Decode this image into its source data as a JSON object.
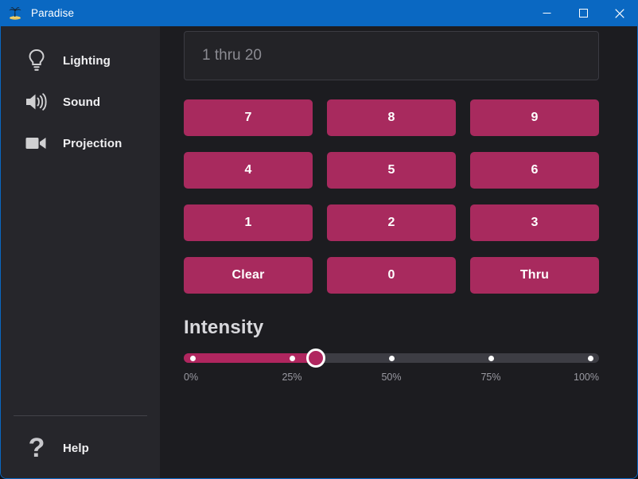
{
  "window": {
    "title": "Paradise",
    "icon": "palm-tree-island-icon",
    "accent_blue": "#0a68c2",
    "controls": {
      "minimize": "minimize-icon",
      "maximize": "maximize-icon",
      "close": "close-icon"
    }
  },
  "sidebar": {
    "items": [
      {
        "label": "Lighting",
        "icon": "lightbulb-icon"
      },
      {
        "label": "Sound",
        "icon": "speaker-icon"
      },
      {
        "label": "Projection",
        "icon": "video-camera-icon"
      }
    ],
    "help": {
      "label": "Help",
      "icon": "question-mark-icon"
    }
  },
  "main": {
    "command_field": {
      "value": "1 thru 20",
      "placeholder": "1 thru 20"
    },
    "keypad": {
      "button_color": "#a82a5e",
      "keys": [
        "7",
        "8",
        "9",
        "4",
        "5",
        "6",
        "1",
        "2",
        "3",
        "Clear",
        "0",
        "Thru"
      ]
    },
    "intensity": {
      "title": "Intensity",
      "value_percent": 31,
      "min": 0,
      "max": 100,
      "fill_color": "#b0265f",
      "track_color": "#3d3d44",
      "ticks": [
        {
          "percent": 0,
          "label": "0%"
        },
        {
          "percent": 25,
          "label": "25%"
        },
        {
          "percent": 50,
          "label": "50%"
        },
        {
          "percent": 75,
          "label": "75%"
        },
        {
          "percent": 100,
          "label": "100%"
        }
      ]
    }
  }
}
